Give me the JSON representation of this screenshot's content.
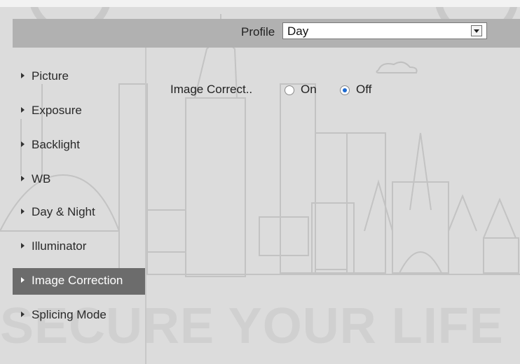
{
  "header": {
    "profile_label": "Profile",
    "profile_value": "Day"
  },
  "sidebar": {
    "items": [
      {
        "label": "Picture"
      },
      {
        "label": "Exposure"
      },
      {
        "label": "Backlight"
      },
      {
        "label": "WB"
      },
      {
        "label": "Day & Night"
      },
      {
        "label": "Illuminator"
      },
      {
        "label": "Image Correction",
        "active": true
      },
      {
        "label": "Splicing Mode"
      }
    ]
  },
  "main": {
    "image_correction": {
      "label": "Image Correct..",
      "options": [
        {
          "label": "On",
          "checked": false
        },
        {
          "label": "Off",
          "checked": true
        }
      ]
    }
  },
  "background": {
    "watermark_text": "SECURE YOUR LIFE"
  },
  "colors": {
    "header_bar": "#b1b1b1",
    "active_nav": "#6c6c6c",
    "page_bg": "#dcdcdc"
  }
}
